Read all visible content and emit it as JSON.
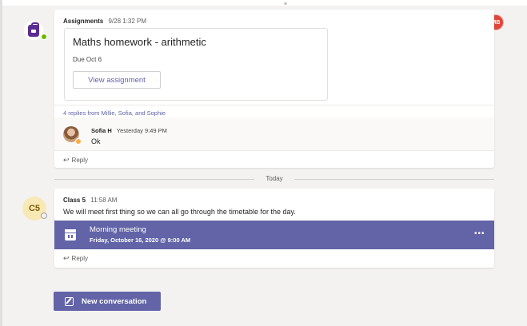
{
  "user": {
    "initials": "MB"
  },
  "post1": {
    "author": "Assignments",
    "timestamp": "9/28 1:32 PM",
    "assignment": {
      "title": "Maths homework - arithmetic",
      "due": "Due Oct 6",
      "button_label": "View assignment"
    },
    "replies_summary": "4 replies from Millie, Sofia, and Sophie",
    "reply": {
      "author": "Sofia H",
      "timestamp": "Yesterday 9:49 PM",
      "text": "Ok"
    },
    "reply_label": "Reply"
  },
  "separator": {
    "label": "Today"
  },
  "post2": {
    "avatar_initials": "C5",
    "author": "Class 5",
    "timestamp": "11:58 AM",
    "text": "We will meet first thing so we can all go through the timetable for the day.",
    "meeting": {
      "title": "Morning meeting",
      "time": "Friday, October 16, 2020 @ 9:00 AM",
      "more": "•••"
    },
    "reply_label": "Reply"
  },
  "new_conversation": {
    "label": "New conversation"
  },
  "colors": {
    "accent": "#6264a7",
    "background": "#f3f2f1",
    "presence_available": "#6bb700",
    "presence_away": "#ffaa44"
  }
}
